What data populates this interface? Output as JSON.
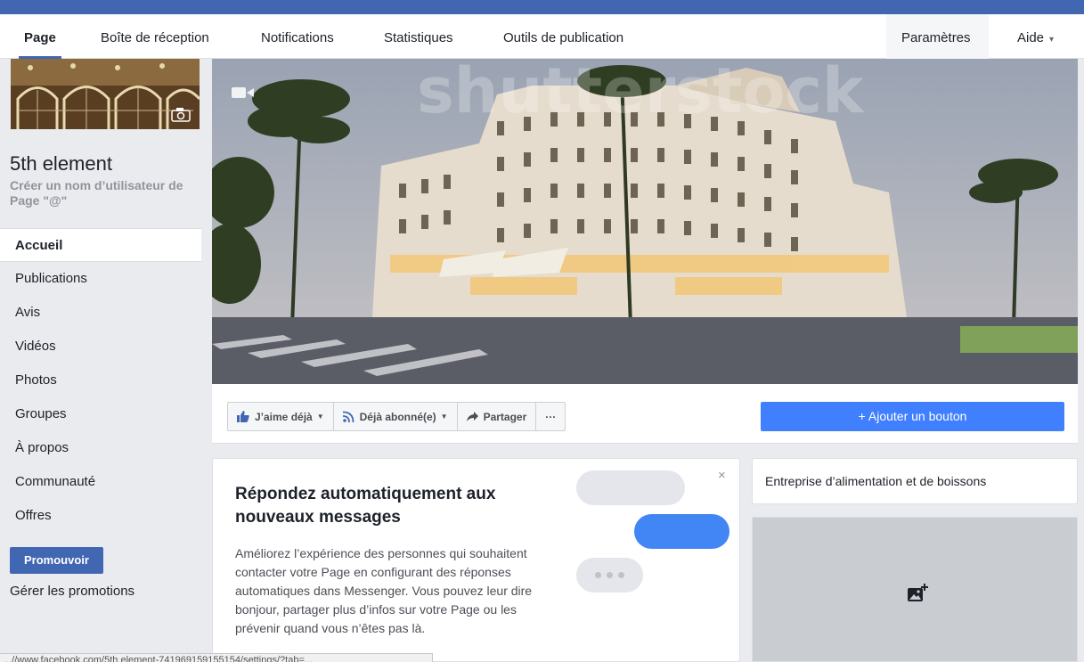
{
  "nav": {
    "items": [
      {
        "label": "Page"
      },
      {
        "label": "Boîte de réception"
      },
      {
        "label": "Notifications"
      },
      {
        "label": "Statistiques"
      },
      {
        "label": "Outils de publication"
      }
    ],
    "settings_label": "Paramètres",
    "help_label": "Aide",
    "help_caret": "▾"
  },
  "sidebar": {
    "page_name": "5th element",
    "username_prompt": "Créer un nom d’utilisateur de Page \"@\"",
    "menu": [
      {
        "label": "Accueil"
      },
      {
        "label": "Publications"
      },
      {
        "label": "Avis"
      },
      {
        "label": "Vidéos"
      },
      {
        "label": "Photos"
      },
      {
        "label": "Groupes"
      },
      {
        "label": "À propos"
      },
      {
        "label": "Communauté"
      },
      {
        "label": "Offres"
      }
    ],
    "promote_label": "Promouvoir",
    "manage_promotions_label": "Gérer les promotions"
  },
  "cover": {
    "watermark": "shutterstock"
  },
  "actions": {
    "like_label": "J’aime déjà",
    "follow_label": "Déjà abonné(e)",
    "share_label": "Partager",
    "more_label": "···",
    "add_button_label": "+ Ajouter un bouton"
  },
  "auto_reply_card": {
    "title": "Répondez automatiquement aux nouveaux messages",
    "body": "Améliorez l’expérience des personnes qui souhaitent contacter votre Page en configurant des réponses automatiques dans Messenger. Vous pouvez leur dire bonjour, partager plus d’infos sur votre Page ou les prévenir quand vous n’êtes pas là.",
    "close_label": "×"
  },
  "right_column": {
    "category": "Entreprise d’alimentation et de boissons"
  },
  "status_bar": {
    "text": "...//www.facebook.com/5th element-741969159155154/settings/?tab=..."
  },
  "colors": {
    "brand": "#4267b2",
    "primary_button": "#4080ff",
    "background": "#e9ebee"
  }
}
